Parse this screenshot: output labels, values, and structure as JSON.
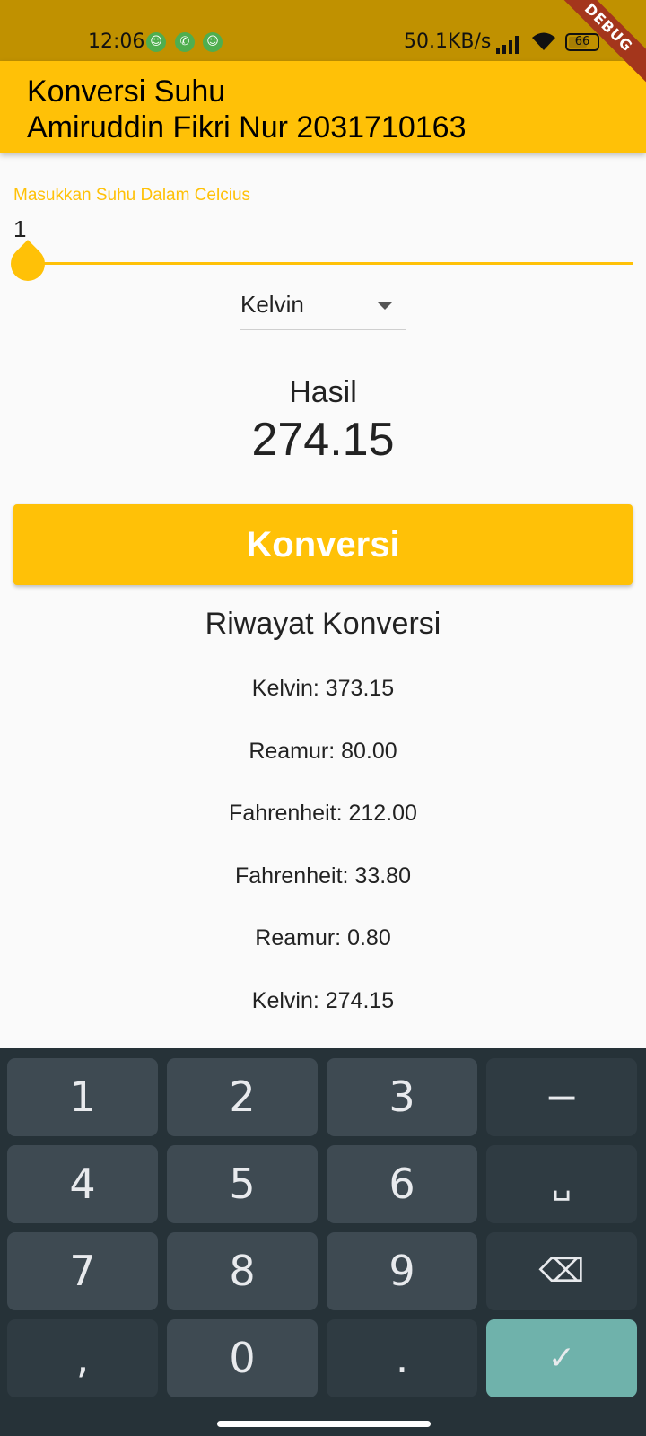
{
  "status_bar": {
    "time": "12:06",
    "speed": "50.1KB/s",
    "battery": "66",
    "debug_label": "DEBUG"
  },
  "app_bar": {
    "title_line1": "Konversi Suhu",
    "title_line2": "Amiruddin Fikri Nur 2031710163"
  },
  "input": {
    "label": "Masukkan Suhu Dalam Celcius",
    "value": "1"
  },
  "dropdown": {
    "selected": "Kelvin"
  },
  "result": {
    "label": "Hasil",
    "value": "274.15"
  },
  "convert_button": {
    "label": "Konversi"
  },
  "history": {
    "title": "Riwayat Konversi",
    "items": [
      "Kelvin: 373.15",
      "Reamur: 80.00",
      "Fahrenheit: 212.00",
      "Fahrenheit: 33.80",
      "Reamur: 0.80",
      "Kelvin: 274.15"
    ]
  },
  "keyboard": {
    "keys": [
      "1",
      "2",
      "3",
      "−",
      "4",
      "5",
      "6",
      "␣",
      "7",
      "8",
      "9",
      "⌫",
      ",",
      "0",
      ".",
      "✓"
    ]
  },
  "colors": {
    "accent": "#ffc107",
    "status_bar": "#c09100",
    "keyboard_bg": "#263238",
    "key_bg": "#3e4a52",
    "confirm_key": "#6fb2ab"
  }
}
